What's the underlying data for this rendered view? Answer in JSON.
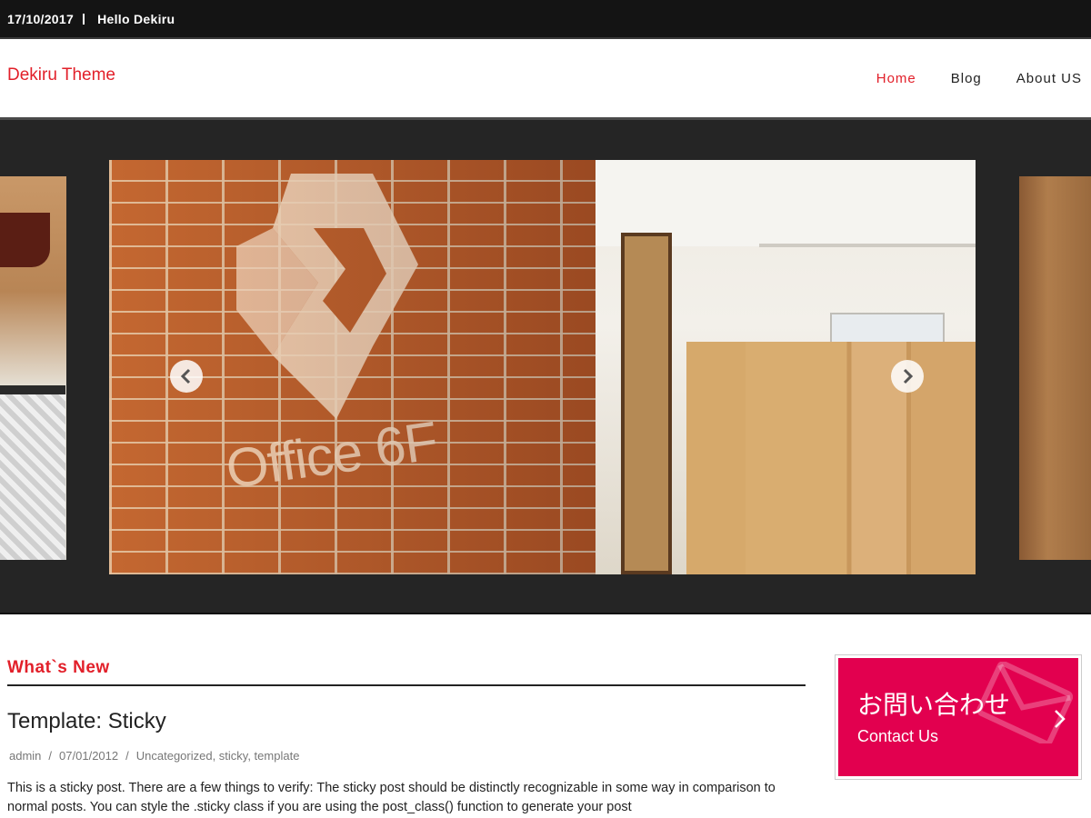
{
  "topbar": {
    "date": "17/10/2017",
    "greeting": "Hello Dekiru"
  },
  "header": {
    "site_title": "Dekiru Theme",
    "nav": [
      {
        "label": "Home",
        "active": true
      },
      {
        "label": "Blog",
        "active": false
      },
      {
        "label": "About US",
        "active": false
      }
    ]
  },
  "slider": {
    "main_slide_wall_text": "Office 6F",
    "prev_icon": "chevron-left-icon",
    "next_icon": "chevron-right-icon"
  },
  "main": {
    "section_title": "What`s New",
    "post": {
      "title": "Template: Sticky",
      "author": "admin",
      "date": "07/01/2012",
      "categories": "Uncategorized, sticky, template",
      "excerpt": "This is a sticky post. There are a few things to verify: The sticky post should be distinctly recognizable in some way in comparison to normal posts. You can style the .sticky class if you are using the post_class() function to generate your post"
    }
  },
  "sidebar": {
    "contact_jp": "お問い合わせ",
    "contact_en": "Contact Us",
    "contact_color": "#e2004f",
    "icon": "mail-icon"
  },
  "colors": {
    "accent": "#e2202a",
    "topbar_bg": "#141414",
    "slider_bg": "#252525"
  }
}
